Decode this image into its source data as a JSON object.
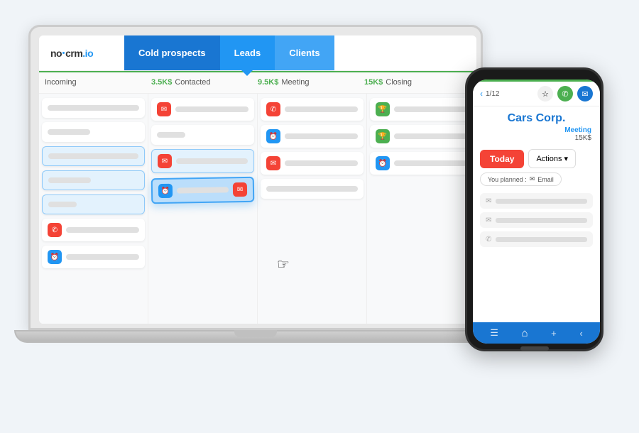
{
  "logo": {
    "prefix": "no",
    "separator": "|",
    "brand": "crm",
    "tld": ".io"
  },
  "nav": {
    "tabs": [
      {
        "id": "cold",
        "label": "Cold prospects",
        "active": false
      },
      {
        "id": "leads",
        "label": "Leads",
        "active": true
      },
      {
        "id": "clients",
        "label": "Clients",
        "active": false
      }
    ]
  },
  "pipeline": {
    "columns": [
      {
        "label": "Incoming",
        "value": "",
        "color": ""
      },
      {
        "label": "Contacted",
        "value": "3.5K$",
        "color": "green"
      },
      {
        "label": "Meeting",
        "value": "9.5K$",
        "color": "green"
      },
      {
        "label": "Closing",
        "value": "15K$",
        "color": "green"
      }
    ]
  },
  "phone": {
    "nav_counter": "1/12",
    "company_name": "Cars Corp.",
    "stage": "Meeting",
    "amount": "15K$",
    "today_label": "Today",
    "actions_label": "Actions",
    "planned_label": "You planned :",
    "planned_type": "Email",
    "bottom_nav_icons": [
      "☰",
      "⌂",
      "+",
      "<"
    ]
  },
  "icons": {
    "email": "✉",
    "phone": "✆",
    "clock": "⏰",
    "trophy": "🏆",
    "chevron_down": "▾",
    "back_arrow": "<",
    "star": "☆",
    "call": "📞",
    "message": "✉"
  }
}
